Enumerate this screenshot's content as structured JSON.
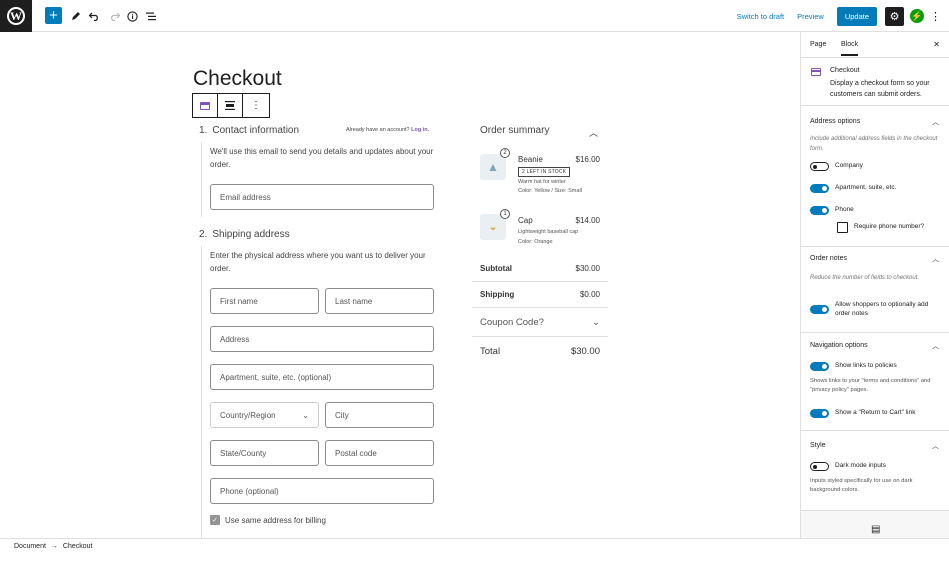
{
  "topbar": {
    "add_icon": "plus",
    "tools_icon": "pencil-icon",
    "undo_icon": "undo-icon",
    "redo_icon": "redo-icon",
    "details_icon": "info-icon",
    "list_view_icon": "list-view-icon",
    "switch_to_draft": "Switch to draft",
    "preview": "Preview",
    "update": "Update"
  },
  "editor": {
    "page_title": "Checkout",
    "contact": {
      "step": "1.",
      "title": "Contact information",
      "login_prompt": "Already have an account?",
      "login_link": "Log in.",
      "helper": "We'll use this email to send you details and updates about your order.",
      "email_placeholder": "Email address"
    },
    "shipping": {
      "step": "2.",
      "title": "Shipping address",
      "helper": "Enter the physical address where you want us to deliver your order.",
      "first_name": "First name",
      "last_name": "Last name",
      "address": "Address",
      "apartment": "Apartment, suite, etc. (optional)",
      "country": "Country/Region",
      "city": "City",
      "state": "State/County",
      "postal": "Postal code",
      "phone": "Phone (optional)",
      "same_billing": "Use same address for billing"
    },
    "summary": {
      "title": "Order summary",
      "items": [
        {
          "qty": "2",
          "name": "Beanie",
          "price": "$16.00",
          "badge": "2 LEFT IN STOCK",
          "desc": "Warm hat for winter",
          "meta": "Color: Yellow / Size: Small"
        },
        {
          "qty": "1",
          "name": "Cap",
          "price": "$14.00",
          "desc": "Lightweight baseball cap",
          "meta": "Color: Orange"
        }
      ],
      "subtotal_label": "Subtotal",
      "subtotal_value": "$30.00",
      "shipping_label": "Shipping",
      "shipping_value": "$0.00",
      "coupon_label": "Coupon Code?",
      "total_label": "Total",
      "total_value": "$30.00"
    }
  },
  "sidebar": {
    "tabs": [
      "Page",
      "Block"
    ],
    "block_title": "Checkout",
    "block_desc": "Display a checkout form so your customers can submit orders.",
    "address_options": {
      "title": "Address options",
      "help": "Include additional address fields in the checkout form.",
      "company": "Company",
      "apartment": "Apartment, suite, etc.",
      "phone": "Phone",
      "require_phone": "Require phone number?"
    },
    "order_notes": {
      "title": "Order notes",
      "help": "Reduce the number of fields to checkout.",
      "allow_notes": "Allow shoppers to optionally add order notes"
    },
    "navigation": {
      "title": "Navigation options",
      "show_policies": "Show links to policies",
      "policies_help": "Shows links to your \"terms and conditions\" and \"privacy policy\" pages.",
      "return_to_cart": "Show a \"Return to Cart\" link"
    },
    "style": {
      "title": "Style",
      "dark_mode": "Dark mode inputs",
      "dark_help": "Inputs styled specifically for use on dark background colors."
    }
  },
  "breadcrumb": {
    "root": "Document",
    "sep": "→",
    "current": "Checkout"
  }
}
